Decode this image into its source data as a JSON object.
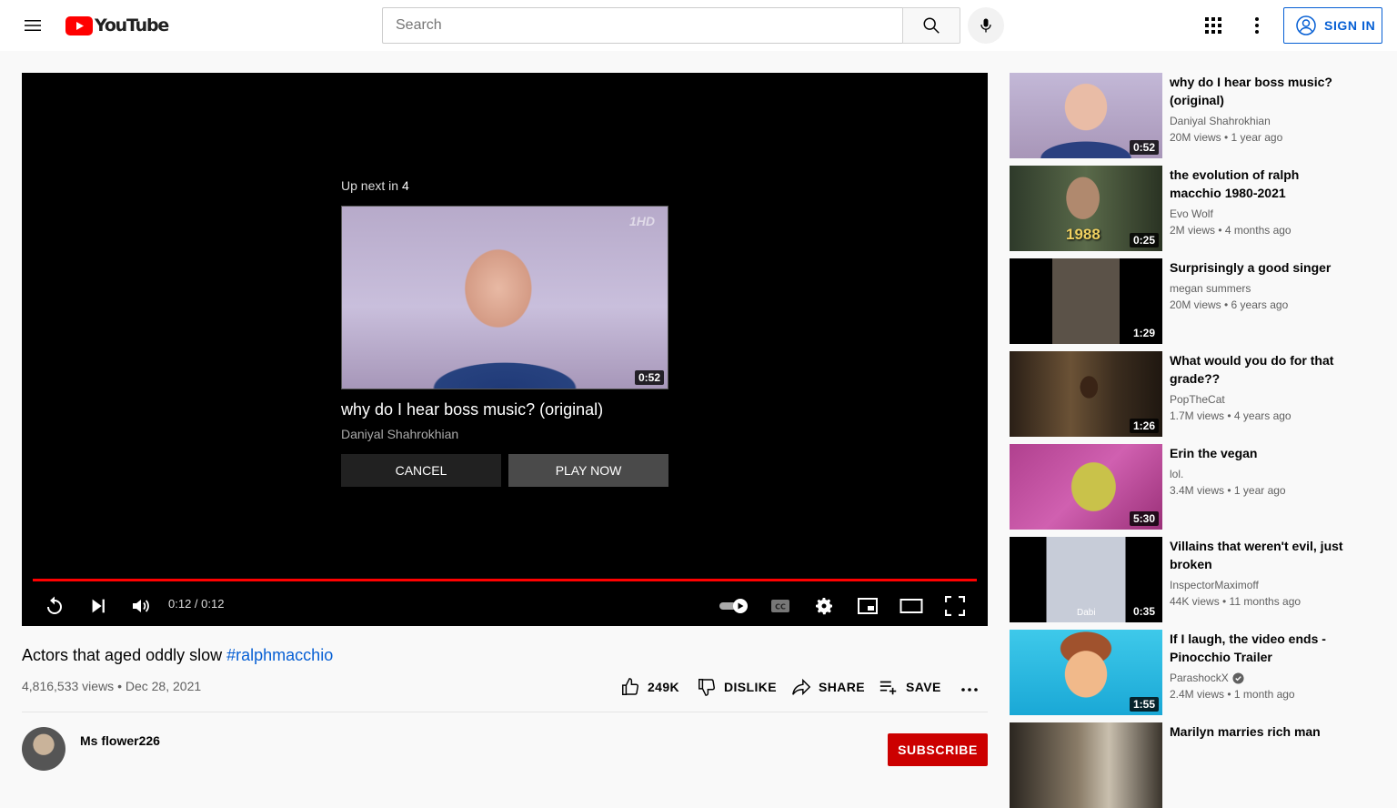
{
  "header": {
    "logo_text": "YouTube",
    "search_placeholder": "Search",
    "signin_label": "SIGN IN"
  },
  "player": {
    "upnext_label": "Up next in",
    "upnext_count": "4",
    "upnext_title": "why do I hear boss music? (original)",
    "upnext_channel": "Daniyal Shahrokhian",
    "upnext_duration": "0:52",
    "upnext_watermark": "1HD",
    "cancel_label": "CANCEL",
    "play_now_label": "PLAY NOW",
    "time": "0:12 / 0:12",
    "progress": 1.0
  },
  "video": {
    "title": "Actors that aged oddly slow",
    "hashtag": "#ralphmacchio",
    "meta": "4,816,533 views • Dec 28, 2021",
    "likes": "249K",
    "dislike_label": "DISLIKE",
    "share_label": "SHARE",
    "save_label": "SAVE",
    "channel": "Ms flower226",
    "subscribe_label": "SUBSCRIBE"
  },
  "recommendations": [
    {
      "title": "why do I hear boss music? (original)",
      "channel": "Daniyal Shahrokhian",
      "stats": "20M views • 1 year ago",
      "duration": "0:52",
      "verified": false
    },
    {
      "title": "the evolution of ralph macchio 1980-2021",
      "channel": "Evo Wolf",
      "stats": "2M views • 4 months ago",
      "duration": "0:25",
      "verified": false,
      "overlay": "1988"
    },
    {
      "title": "Surprisingly a good singer",
      "channel": "megan summers",
      "stats": "20M views • 6 years ago",
      "duration": "1:29",
      "verified": false
    },
    {
      "title": "What would you do for that grade??",
      "channel": "PopTheCat",
      "stats": "1.7M views • 4 years ago",
      "duration": "1:26",
      "verified": false
    },
    {
      "title": "Erin the vegan",
      "channel": "lol.",
      "stats": "3.4M views • 1 year ago",
      "duration": "5:30",
      "verified": false
    },
    {
      "title": "Villains that weren't evil, just broken",
      "channel": "InspectorMaximoff",
      "stats": "44K views • 11 months ago",
      "duration": "0:35",
      "verified": false,
      "overlay": "Dabi"
    },
    {
      "title": "If I laugh, the video ends - Pinocchio Trailer",
      "channel": "ParashockX",
      "stats": "2.4M views • 1 month ago",
      "duration": "1:55",
      "verified": true
    },
    {
      "title": "Marilyn marries rich man",
      "channel": "",
      "stats": "",
      "duration": "",
      "verified": false
    }
  ],
  "colors": {
    "accent_blue": "#065fd4",
    "youtube_red": "#ff0000",
    "subscribe_red": "#cc0000"
  }
}
